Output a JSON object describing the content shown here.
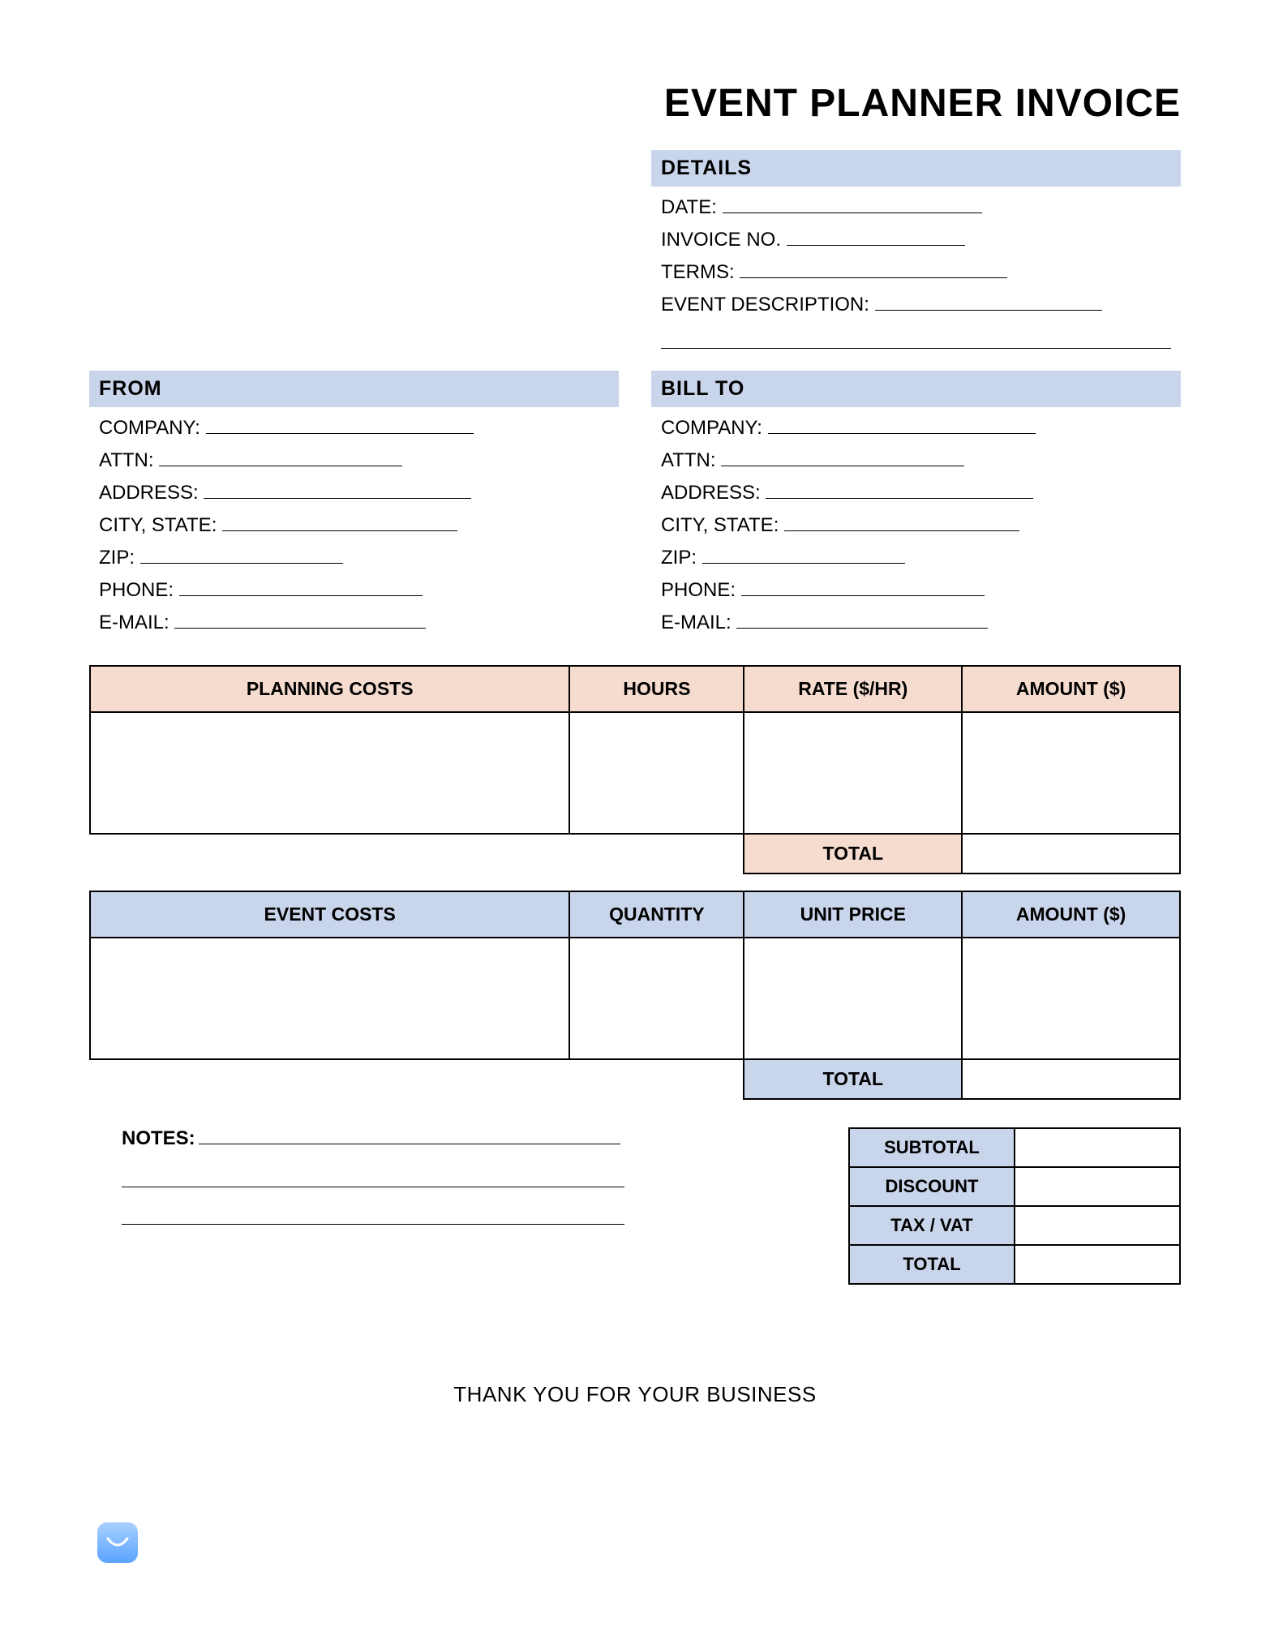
{
  "title": "EVENT PLANNER INVOICE",
  "details": {
    "header": "DETAILS",
    "date_label": "DATE:",
    "invoice_no_label": "INVOICE NO.",
    "terms_label": "TERMS:",
    "event_desc_label": "EVENT DESCRIPTION:"
  },
  "from": {
    "header": "FROM",
    "company_label": "COMPANY:",
    "attn_label": "ATTN:",
    "address_label": "ADDRESS:",
    "city_state_label": "CITY, STATE:",
    "zip_label": "ZIP:",
    "phone_label": "PHONE:",
    "email_label": "E-MAIL:"
  },
  "bill_to": {
    "header": "BILL TO",
    "company_label": "COMPANY:",
    "attn_label": "ATTN:",
    "address_label": "ADDRESS:",
    "city_state_label": "CITY, STATE:",
    "zip_label": "ZIP:",
    "phone_label": "PHONE:",
    "email_label": "E-MAIL:"
  },
  "planning_table": {
    "h_desc": "PLANNING COSTS",
    "h_hours": "HOURS",
    "h_rate": "RATE ($/HR)",
    "h_amount": "AMOUNT ($)",
    "total_label": "TOTAL"
  },
  "event_table": {
    "h_desc": "EVENT COSTS",
    "h_qty": "QUANTITY",
    "h_unit": "UNIT PRICE",
    "h_amount": "AMOUNT ($)",
    "total_label": "TOTAL"
  },
  "notes_label": "NOTES:",
  "summary": {
    "subtotal": "SUBTOTAL",
    "discount": "DISCOUNT",
    "tax": "TAX / VAT",
    "total": "TOTAL"
  },
  "thanks": "THANK YOU FOR YOUR BUSINESS"
}
